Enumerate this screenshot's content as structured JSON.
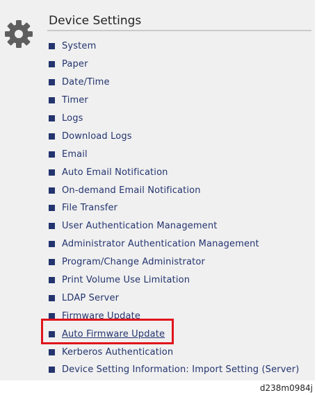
{
  "header": {
    "title": "Device Settings",
    "icon": "gear-icon"
  },
  "menu": {
    "items": [
      {
        "label": "System"
      },
      {
        "label": "Paper"
      },
      {
        "label": "Date/Time"
      },
      {
        "label": "Timer"
      },
      {
        "label": "Logs"
      },
      {
        "label": "Download Logs"
      },
      {
        "label": "Email"
      },
      {
        "label": "Auto Email Notification"
      },
      {
        "label": "On-demand Email Notification"
      },
      {
        "label": "File Transfer"
      },
      {
        "label": "User Authentication Management"
      },
      {
        "label": "Administrator Authentication Management"
      },
      {
        "label": "Program/Change Administrator"
      },
      {
        "label": "Print Volume Use Limitation"
      },
      {
        "label": "LDAP Server"
      },
      {
        "label": "Firmware Update"
      },
      {
        "label": "Auto Firmware Update"
      },
      {
        "label": "Kerberos Authentication"
      },
      {
        "label": "Device Setting Information: Import Setting (Server)"
      }
    ],
    "highlighted_item": "Auto Firmware Update"
  },
  "caption": "d238m0984j",
  "colors": {
    "link": "#23346e",
    "highlight_border": "#e0141b",
    "panel_background": "#f0f0f0"
  }
}
